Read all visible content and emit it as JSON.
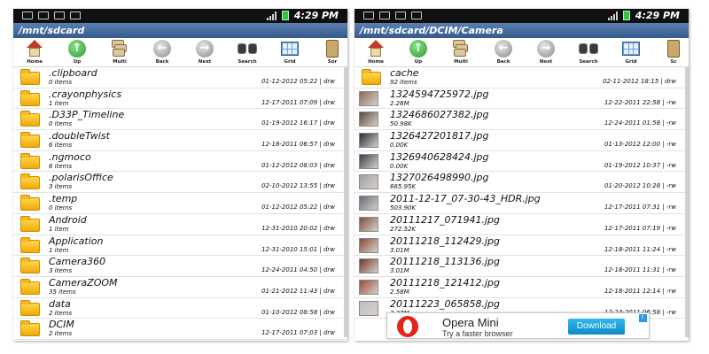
{
  "status_bar": {
    "time": "4:29 PM"
  },
  "colors": {
    "path_bar": "#3b5f92",
    "folder": "#f5b800",
    "ad_button": "#1a9ee0",
    "battery": "#35c14a"
  },
  "left_panel": {
    "path": "/mnt/sdcard",
    "toolbar": [
      {
        "label": "Home",
        "icon": "home-icon"
      },
      {
        "label": "Up",
        "icon": "up-arrow-icon"
      },
      {
        "label": "Multi",
        "icon": "multi-select-icon"
      },
      {
        "label": "Back",
        "icon": "back-arrow-icon"
      },
      {
        "label": "Next",
        "icon": "next-arrow-icon"
      },
      {
        "label": "Search",
        "icon": "binoculars-icon"
      },
      {
        "label": "Grid",
        "icon": "grid-icon"
      },
      {
        "label": "Sor",
        "icon": "sort-icon"
      }
    ],
    "items": [
      {
        "name": ".clipboard",
        "meta": "0 items",
        "date": "01-12-2012 05:22 | drw"
      },
      {
        "name": ".crayonphysics",
        "meta": "1 item",
        "date": "12-17-2011 07:09 | drw"
      },
      {
        "name": ".D33P_Timeline",
        "meta": "0 items",
        "date": "01-19-2012 16:17 | drw"
      },
      {
        "name": ".doubleTwist",
        "meta": "6 items",
        "date": "12-18-2011 06:57 | drw"
      },
      {
        "name": ".ngmoco",
        "meta": "6 items",
        "date": "01-12-2012 08:03 | drw"
      },
      {
        "name": ".polarisOffice",
        "meta": "3 items",
        "date": "02-10-2012 13:55 | drw"
      },
      {
        "name": ".temp",
        "meta": "0 items",
        "date": "01-12-2012 05:22 | drw"
      },
      {
        "name": "Android",
        "meta": "1 item",
        "date": "12-31-2010 20:02 | drw"
      },
      {
        "name": "Application",
        "meta": "1 item",
        "date": "12-31-2010 15:01 | drw"
      },
      {
        "name": "Camera360",
        "meta": "3 items",
        "date": "12-24-2011 04:50 | drw"
      },
      {
        "name": "CameraZOOM",
        "meta": "35 items",
        "date": "01-21-2012 11:43 | drw"
      },
      {
        "name": "data",
        "meta": "2 items",
        "date": "01-10-2012 08:58 | drw"
      },
      {
        "name": "DCIM",
        "meta": "2 items",
        "date": "12-17-2011 07:03 | drw"
      }
    ]
  },
  "right_panel": {
    "path": "/mnt/sdcard/DCIM/Camera",
    "toolbar": [
      {
        "label": "Home",
        "icon": "home-icon"
      },
      {
        "label": "Up",
        "icon": "up-arrow-icon"
      },
      {
        "label": "Multi",
        "icon": "multi-select-icon"
      },
      {
        "label": "Back",
        "icon": "back-arrow-icon"
      },
      {
        "label": "Next",
        "icon": "next-arrow-icon"
      },
      {
        "label": "Search",
        "icon": "binoculars-icon"
      },
      {
        "label": "Grid",
        "icon": "grid-icon"
      },
      {
        "label": "Sc",
        "icon": "sort-icon"
      }
    ],
    "items": [
      {
        "name": "cache",
        "meta": "92 items",
        "date": "02-11-2012 18:15 | drw",
        "kind": "folder"
      },
      {
        "name": "1324594725972.jpg",
        "meta": "2.26M",
        "date": "12-22-2011 22:58 | -rw",
        "kind": "image"
      },
      {
        "name": "1324686027382.jpg",
        "meta": "50.98K",
        "date": "12-24-2011 01:58 | -rw",
        "kind": "image"
      },
      {
        "name": "1326427201817.jpg",
        "meta": "0.00K",
        "date": "01-13-2012 12:00 | -rw",
        "kind": "image"
      },
      {
        "name": "1326940628424.jpg",
        "meta": "0.00K",
        "date": "01-19-2012 10:37 | -rw",
        "kind": "image"
      },
      {
        "name": "1327026498990.jpg",
        "meta": "665.95K",
        "date": "01-20-2012 10:28 | -rw",
        "kind": "image"
      },
      {
        "name": "2011-12-17_07-30-43_HDR.jpg",
        "meta": "503.90K",
        "date": "12-17-2011 07:31 | -rw",
        "kind": "image"
      },
      {
        "name": "20111217_071941.jpg",
        "meta": "272.52K",
        "date": "12-17-2011 07:19 | -rw",
        "kind": "image"
      },
      {
        "name": "20111218_112429.jpg",
        "meta": "3.01M",
        "date": "12-18-2011 11:24 | -rw",
        "kind": "image"
      },
      {
        "name": "20111218_113136.jpg",
        "meta": "3.01M",
        "date": "12-18-2011 11:31 | -rw",
        "kind": "image"
      },
      {
        "name": "20111218_121412.jpg",
        "meta": "2.58M",
        "date": "12-18-2011 12:14 | -rw",
        "kind": "image"
      },
      {
        "name": "20111223_065858.jpg",
        "meta": "2.27M",
        "date": "12-23-2011 06:58 | -rw",
        "kind": "image"
      }
    ]
  },
  "ad": {
    "title": "Opera Mini",
    "subtitle": "Try a faster browser",
    "button": "Download"
  }
}
